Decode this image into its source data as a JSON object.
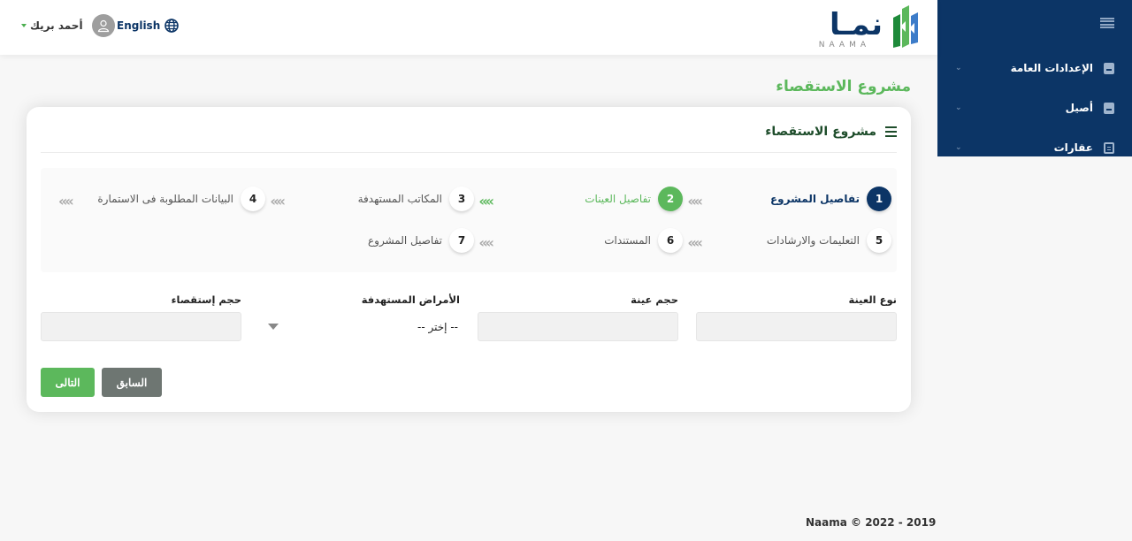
{
  "brand": {
    "name_ar": "نمـا",
    "name_en": "NAAMA"
  },
  "header": {
    "language_label": "English",
    "user_name": "أحمد بريك"
  },
  "sidebar": {
    "items": [
      {
        "label": "الإعدادات العامة",
        "icon": "book-icon"
      },
      {
        "label": "أصيل",
        "icon": "book-icon"
      },
      {
        "label": "عقارات",
        "icon": "building-icon"
      }
    ]
  },
  "page": {
    "title": "مشروع الاستقصاء",
    "card_title": "مشروع الاستقصاء"
  },
  "stepper": {
    "steps": [
      {
        "number": "1",
        "label": "تفاصيل المشروع",
        "state": "completed"
      },
      {
        "number": "2",
        "label": "تفاصيل العينات",
        "state": "current"
      },
      {
        "number": "3",
        "label": "المكاتب المستهدفة",
        "state": "pending"
      },
      {
        "number": "4",
        "label": "البيانات المطلوبة فى الاستمارة",
        "state": "pending"
      },
      {
        "number": "5",
        "label": "التعليمات والارشادات",
        "state": "pending"
      },
      {
        "number": "6",
        "label": "المستندات",
        "state": "pending"
      },
      {
        "number": "7",
        "label": "تفاصيل المشروع",
        "state": "pending"
      }
    ],
    "arrow_glyph": "«"
  },
  "form": {
    "sample_type": {
      "label": "نوع العينة",
      "value": ""
    },
    "sample_size": {
      "label": "حجم عينة",
      "value": ""
    },
    "target_diseases": {
      "label": "الأمراض المستهدفة",
      "selected": "-- إختر --"
    },
    "survey_size": {
      "label": "حجم إستقصاء",
      "value": ""
    }
  },
  "buttons": {
    "previous": "السابق",
    "next": "التالى"
  },
  "footer": {
    "text": "Naama © 2022 - 2019"
  },
  "colors": {
    "primary": "#0c3566",
    "accent": "#5cb85c",
    "secondary_button": "#6e7672"
  }
}
